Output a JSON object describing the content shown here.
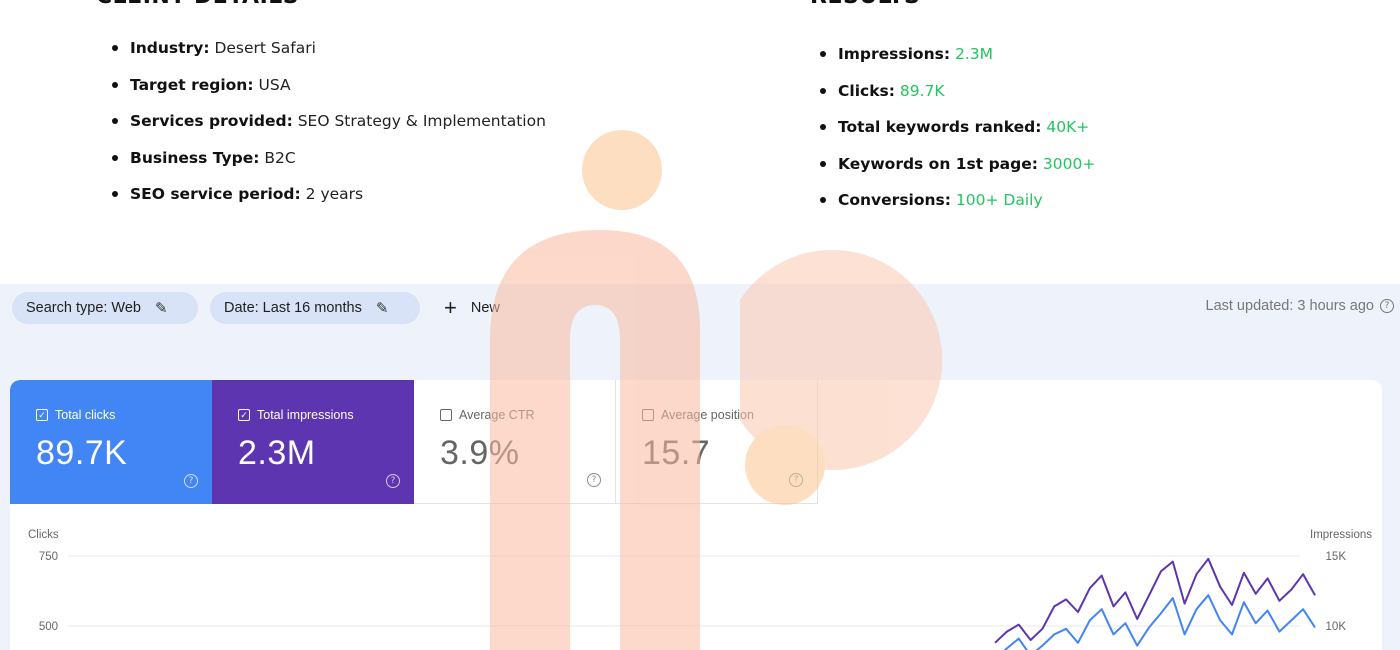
{
  "client": {
    "heading": "CLEINT DETAILS",
    "items": [
      {
        "label": "Industry:",
        "value": "Desert Safari"
      },
      {
        "label": "Target region:",
        "value": "USA"
      },
      {
        "label": "Services provided:",
        "value": "SEO Strategy & Implementation"
      },
      {
        "label": "Business Type:",
        "value": "B2C"
      },
      {
        "label": "SEO service period:",
        "value": "2 years"
      }
    ]
  },
  "results": {
    "heading": "RESULTS",
    "items": [
      {
        "label": "Impressions:",
        "value": "2.3M"
      },
      {
        "label": "Clicks:",
        "value": "89.7K"
      },
      {
        "label": "Total keywords ranked:",
        "value": "40K+"
      },
      {
        "label": "Keywords on 1st page:",
        "value": "3000+"
      },
      {
        "label": "Conversions:",
        "value": "100+ Daily"
      }
    ]
  },
  "filters": {
    "search_type": "Search type: Web",
    "date": "Date: Last 16 months",
    "new_label": "New",
    "last_updated": "Last updated: 3 hours ago"
  },
  "metrics": [
    {
      "label": "Total clicks",
      "value": "89.7K",
      "checked": true
    },
    {
      "label": "Total impressions",
      "value": "2.3M",
      "checked": true
    },
    {
      "label": "Average CTR",
      "value": "3.9%",
      "checked": false
    },
    {
      "label": "Average position",
      "value": "15.7",
      "checked": false
    }
  ],
  "colors": {
    "clicks": "#4285f4",
    "impressions": "#5e35b1",
    "accent_green": "#22c55e",
    "watermark": "#fbd9c0"
  },
  "chart_data": {
    "type": "line",
    "y_left": {
      "label": "Clicks",
      "ticks": [
        "750",
        "500"
      ],
      "range": [
        0,
        750
      ]
    },
    "y_right": {
      "label": "Impressions",
      "ticks": [
        "15K",
        "10K"
      ],
      "range": [
        0,
        15000
      ]
    },
    "series": [
      {
        "name": "Clicks",
        "axis": "left",
        "color": "#4285f4",
        "values": [
          380,
          420,
          455,
          395,
          430,
          470,
          490,
          440,
          520,
          560,
          470,
          510,
          430,
          495,
          545,
          600,
          470,
          560,
          610,
          520,
          470,
          585,
          510,
          555,
          480,
          520,
          560,
          495
        ]
      },
      {
        "name": "Impressions",
        "axis": "right",
        "color": "#5e35b1",
        "values": [
          8800,
          9600,
          10100,
          9000,
          9800,
          11400,
          11900,
          11000,
          12700,
          13600,
          11400,
          12400,
          10500,
          12200,
          13900,
          14600,
          11600,
          13700,
          14800,
          12800,
          11500,
          13800,
          12300,
          13400,
          11800,
          12600,
          13700,
          12200
        ]
      }
    ]
  }
}
